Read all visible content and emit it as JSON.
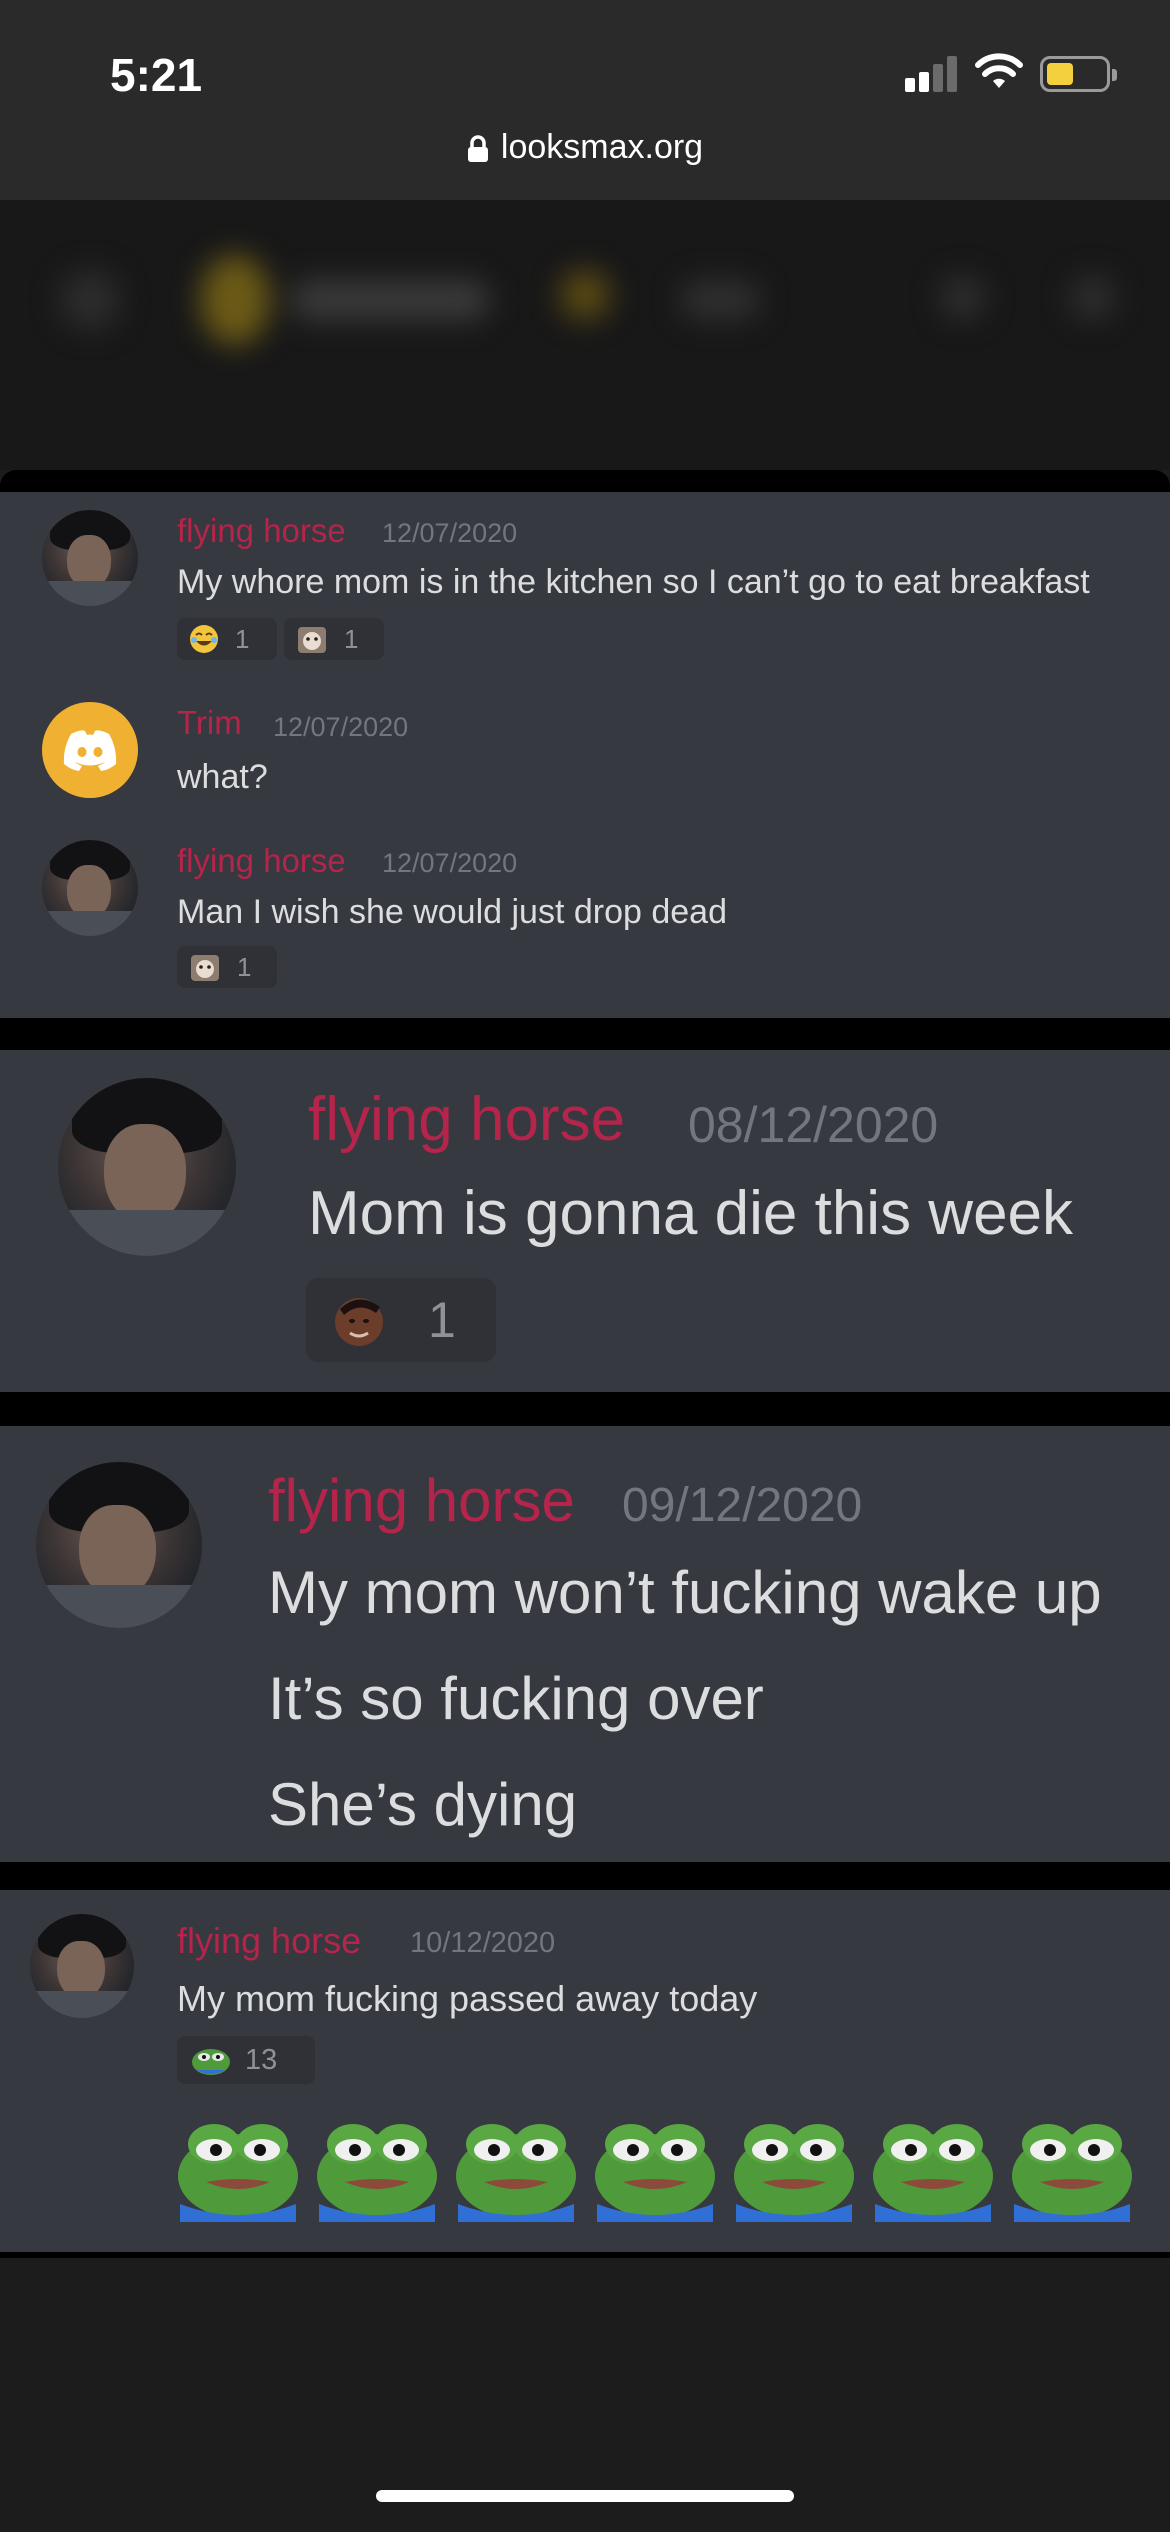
{
  "status_bar": {
    "time": "5:21",
    "url": "looksmax.org",
    "battery_color": "#f4d03f"
  },
  "colors": {
    "discord_bg": "#36393f",
    "username": "#b5244b",
    "timestamp": "#72767d",
    "message_text": "#dcddde"
  },
  "screenshots": [
    {
      "messages": [
        {
          "author": "flying horse",
          "timestamp": "12/07/2020",
          "lines": [
            "My whore mom is in the kitchen so I can’t go to eat breakfast"
          ],
          "reactions": [
            {
              "emoji": "joy-emoji",
              "count": "1"
            },
            {
              "emoji": "cat-emoji",
              "count": "1"
            }
          ]
        },
        {
          "author": "Trim",
          "timestamp": "12/07/2020",
          "lines": [
            "what?"
          ],
          "reactions": []
        },
        {
          "author": "flying horse",
          "timestamp": "12/07/2020",
          "lines": [
            "Man I wish she would just drop dead"
          ],
          "reactions": [
            {
              "emoji": "cat-emoji",
              "count": "1"
            }
          ]
        }
      ]
    },
    {
      "messages": [
        {
          "author": "flying horse",
          "timestamp": "08/12/2020",
          "lines": [
            "Mom is gonna die this week"
          ],
          "reactions": [
            {
              "emoji": "face-emoji",
              "count": "1"
            }
          ]
        }
      ]
    },
    {
      "messages": [
        {
          "author": "flying horse",
          "timestamp": "09/12/2020",
          "lines": [
            "My mom won’t fucking wake up",
            "It’s so fucking over",
            "She’s dying"
          ],
          "reactions": []
        }
      ]
    },
    {
      "messages": [
        {
          "author": "flying horse",
          "timestamp": "10/12/2020",
          "lines": [
            "My mom fucking passed away today"
          ],
          "reactions": [
            {
              "emoji": "pepe-cry-emoji",
              "count": "13"
            }
          ],
          "emoji_row": [
            "pepe-cry-emoji",
            "pepe-cry-emoji",
            "pepe-cry-emoji",
            "pepe-cry-emoji",
            "pepe-cry-emoji",
            "pepe-cry-emoji",
            "pepe-cry-emoji"
          ]
        }
      ]
    }
  ]
}
